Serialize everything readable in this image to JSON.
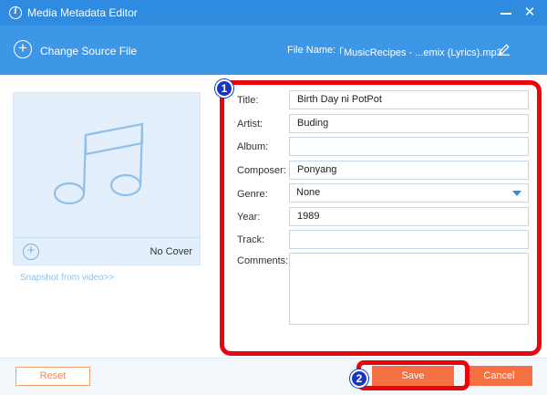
{
  "window": {
    "title": "Media Metadata Editor",
    "info_icon": "info-icon",
    "minimize_icon": "minimize-icon",
    "close_icon": "close-icon",
    "close_glyph": "✕",
    "accent_color": "#2f8be0"
  },
  "header": {
    "add_glyph": "+",
    "change_source_label": "Change Source File",
    "file_name_label": "File Name:",
    "file_name_value": "「MusicRecipes -    ...emix (Lyrics).mp3",
    "edit_icon": "pencil-icon"
  },
  "cover": {
    "add_glyph": "+",
    "no_cover_label": "No Cover",
    "snapshot_link": "Snapshot from video>>",
    "placeholder_icon": "music-note-icon"
  },
  "form": {
    "title": {
      "label": "Title:",
      "value": "Birth Day ni PotPot"
    },
    "artist": {
      "label": "Artist:",
      "value": "Buding"
    },
    "album": {
      "label": "Album:",
      "value": ""
    },
    "composer": {
      "label": "Composer:",
      "value": "Ponyang"
    },
    "genre": {
      "label": "Genre:",
      "value": "None"
    },
    "year": {
      "label": "Year:",
      "value": "1989"
    },
    "track": {
      "label": "Track:",
      "value": ""
    },
    "comments": {
      "label": "Comments:",
      "value": ""
    }
  },
  "annotations": {
    "badge_1": "1",
    "badge_2": "2",
    "highlight_color": "#e8060a",
    "badge_color": "#1337c2"
  },
  "footer": {
    "reset_label": "Reset",
    "save_label": "Save",
    "cancel_label": "Cancel",
    "button_color": "#f57143"
  }
}
